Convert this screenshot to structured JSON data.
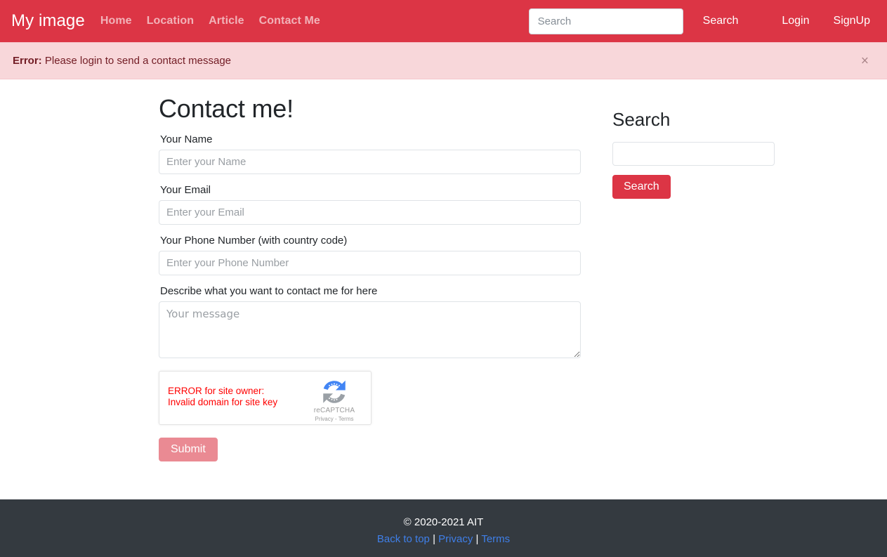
{
  "navbar": {
    "brand": "My image",
    "links": [
      {
        "label": "Home",
        "name": "nav-link-home"
      },
      {
        "label": "Location",
        "name": "nav-link-location"
      },
      {
        "label": "Article",
        "name": "nav-link-article"
      },
      {
        "label": "Contact Me",
        "name": "nav-link-contact-me"
      }
    ],
    "search_placeholder": "Search",
    "search_value": "",
    "search_button": "Search",
    "login": "Login",
    "signup": "SignUp",
    "bg_color": "#dc3545"
  },
  "alert": {
    "prefix": "Error:",
    "message": "Please login to send a contact message",
    "close_icon": "×",
    "bg_color": "#f8d7da",
    "text_color": "#721c24"
  },
  "form": {
    "title": "Contact me!",
    "fields": [
      {
        "label": "Your Name",
        "placeholder": "Enter your Name",
        "value": "",
        "name": "name-field"
      },
      {
        "label": "Your Email",
        "placeholder": "Enter your Email",
        "value": "",
        "name": "email-field"
      },
      {
        "label": "Your Phone Number (with country code)",
        "placeholder": "Enter your Phone Number",
        "value": "",
        "name": "phone-field"
      }
    ],
    "message_label": "Describe what you want to contact me for here",
    "message_placeholder": "Your message",
    "message_value": "",
    "submit_label": "Submit",
    "submit_color": "#ea8a93"
  },
  "recaptcha": {
    "error_line1": "ERROR for site owner:",
    "error_line2": "Invalid domain for site key",
    "brand": "reCAPTCHA",
    "privacy": "Privacy",
    "separator": " - ",
    "terms": "Terms",
    "error_color": "#ff0000"
  },
  "sidebar": {
    "title": "Search",
    "input_value": "",
    "input_placeholder": "",
    "button_label": "Search",
    "button_color": "#dc3545"
  },
  "footer": {
    "copyright": "© 2020-2021 AIT",
    "back_to_top": "Back to top",
    "privacy": "Privacy",
    "terms": "Terms",
    "separator": "|",
    "bg_color": "#343a40",
    "link_color": "#3f7fe8"
  }
}
